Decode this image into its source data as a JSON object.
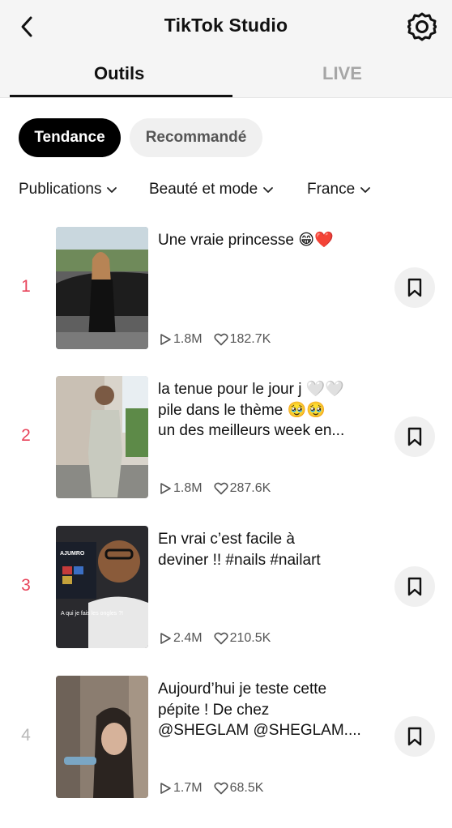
{
  "header": {
    "title": "TikTok Studio",
    "back_icon": "chevron-left-icon",
    "settings_icon": "gear-icon"
  },
  "tabs": [
    {
      "label": "Outils",
      "active": true
    },
    {
      "label": "LIVE",
      "active": false
    }
  ],
  "chips": [
    {
      "label": "Tendance",
      "active": true
    },
    {
      "label": "Recommandé",
      "active": false
    }
  ],
  "filters": [
    {
      "label": "Publications"
    },
    {
      "label": "Beauté et mode"
    },
    {
      "label": "France"
    }
  ],
  "items": [
    {
      "rank": "1",
      "caption": [
        "Une vraie princesse 😁❤️"
      ],
      "views": "1.8M",
      "likes": "182.7K"
    },
    {
      "rank": "2",
      "caption": [
        "la tenue pour le jour j 🤍🤍",
        "pile dans le thème 🥹🥹",
        "un des meilleurs week en..."
      ],
      "views": "1.8M",
      "likes": "287.6K"
    },
    {
      "rank": "3",
      "caption": [
        "En vrai c’est facile à",
        "deviner !! #nails #nailart"
      ],
      "views": "2.4M",
      "likes": "210.5K",
      "thumb_overlay": [
        "AJUMRO",
        "A qui je fais les ongles ?!"
      ]
    },
    {
      "rank": "4",
      "caption": [
        "Aujourd’hui je teste cette",
        "pépite ! De chez",
        "@SHEGLAM @SHEGLAM...."
      ],
      "views": "1.7M",
      "likes": "68.5K"
    }
  ],
  "colors": {
    "rank_top": "#e8435a",
    "rank_other": "#b8b8b8",
    "active_chip": "#000000",
    "header_bg": "#f5f5f5"
  }
}
